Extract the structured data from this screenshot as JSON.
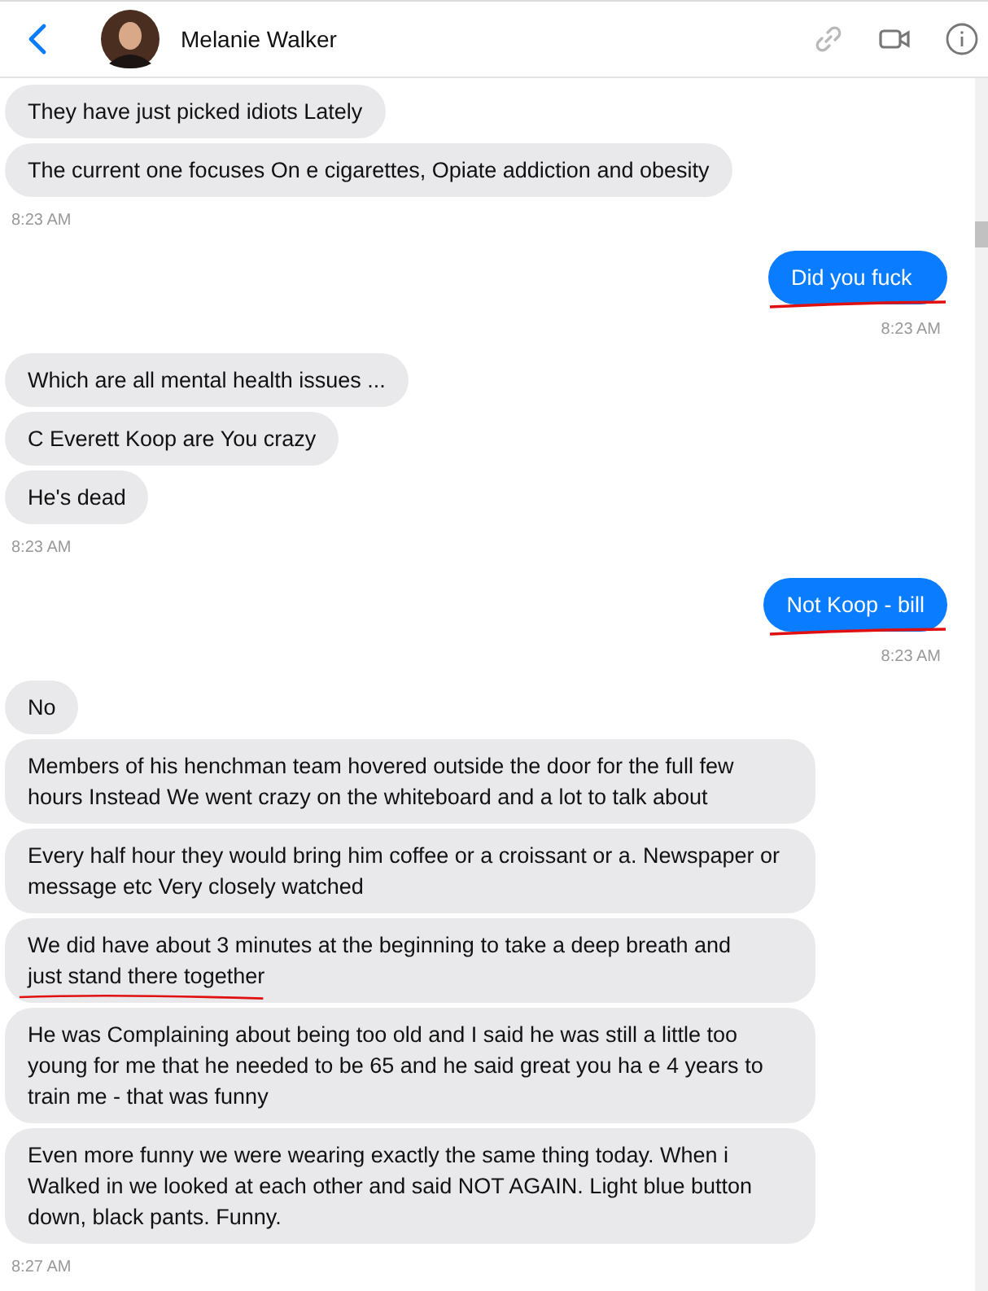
{
  "header": {
    "contact_name": "Melanie Walker"
  },
  "entries": [
    {
      "kind": "in",
      "text": "They have just picked idiots Lately",
      "underlined": false
    },
    {
      "kind": "in",
      "text": "The current one focuses On e cigarettes, Opiate addiction and obesity",
      "underlined": false
    },
    {
      "kind": "time",
      "text": "8:23 AM"
    },
    {
      "kind": "out",
      "text": "Did you fuck",
      "underlined": true
    },
    {
      "kind": "time",
      "text": "8:23 AM"
    },
    {
      "kind": "in",
      "text": "Which are all mental health issues ...",
      "underlined": false
    },
    {
      "kind": "in",
      "text": "C Everett Koop are You crazy",
      "underlined": false
    },
    {
      "kind": "in",
      "text": "He's dead",
      "underlined": false
    },
    {
      "kind": "time",
      "text": "8:23 AM"
    },
    {
      "kind": "out",
      "text": "Not Koop - bill",
      "underlined": true
    },
    {
      "kind": "time",
      "text": "8:23 AM"
    },
    {
      "kind": "in",
      "text": "No",
      "underlined": false
    },
    {
      "kind": "in",
      "text": "Members of his henchman team hovered outside the door for the full few hours Instead We went crazy on the whiteboard and a lot to talk about",
      "underlined": false
    },
    {
      "kind": "in",
      "text": "Every half hour they would bring him coffee or a croissant or a. Newspaper or message etc Very closely watched",
      "underlined": false
    },
    {
      "kind": "in",
      "text": "We did have about 3 minutes at the beginning to take a deep breath and",
      "underlined_text": "just stand there together",
      "underlined": false
    },
    {
      "kind": "in",
      "text": "He was Complaining about being too old and I said he was still a little too young for me that he needed to be 65 and he said great you ha e 4 years to train me - that was funny",
      "underlined": false
    },
    {
      "kind": "in",
      "text": "Even more funny we were wearing exactly the same thing today. When i Walked in we looked at each other and said NOT AGAIN. Light blue button down, black pants. Funny.",
      "underlined": false
    },
    {
      "kind": "time",
      "text": "8:27 AM"
    }
  ]
}
